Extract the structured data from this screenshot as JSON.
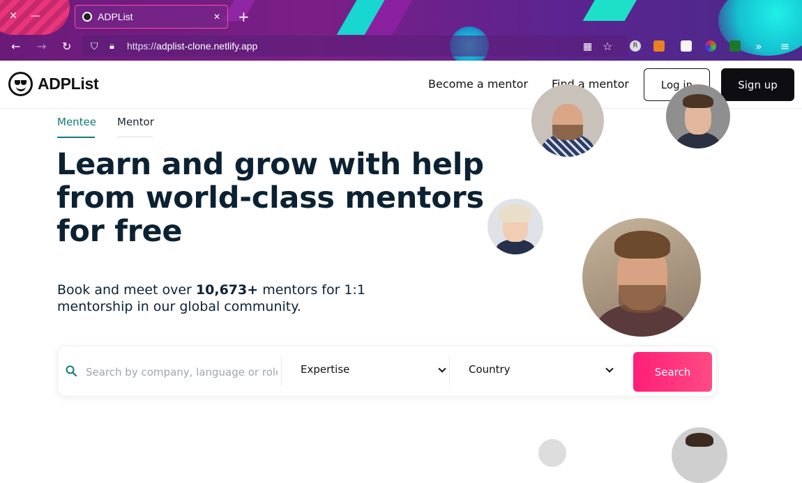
{
  "browser": {
    "tab_title": "ADPList",
    "url_prefix": "https://",
    "url_domain": "adplist-clone.netlify.app",
    "ext_r_label": "R"
  },
  "header": {
    "logo_text": "ADPList",
    "nav": [
      "Become a mentor",
      "Find a mentor"
    ],
    "login_label": "Log in",
    "signup_label": "Sign up"
  },
  "role_tabs": [
    "Mentee",
    "Mentor"
  ],
  "hero": {
    "title": "Learn and grow with help from world-class mentors for free",
    "sub_before": "Book and meet over ",
    "sub_count": "10,673+",
    "sub_after": " mentors for 1:1 mentorship in our global community."
  },
  "search": {
    "placeholder": "Search by company, language or role",
    "expertise_label": "Expertise",
    "country_label": "Country",
    "button_label": "Search"
  },
  "colors": {
    "accent": "#127a73",
    "cta": "#ff1e78",
    "dark": "#0c2233"
  }
}
